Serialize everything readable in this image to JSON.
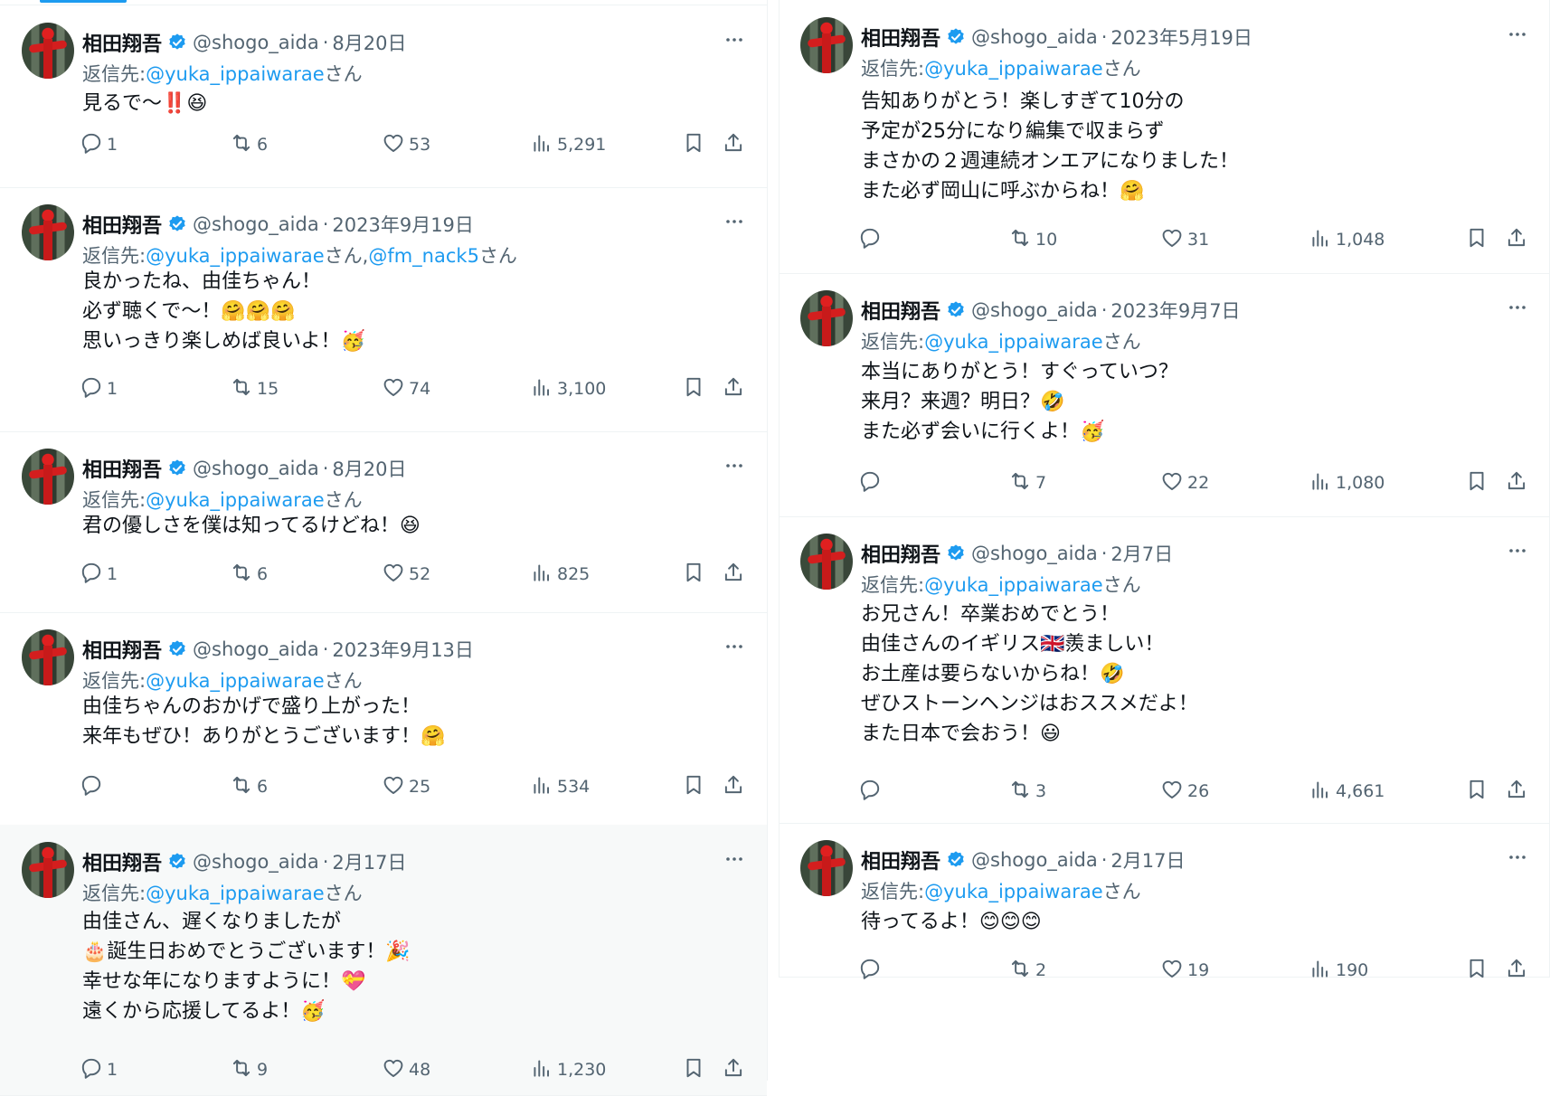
{
  "colors": {
    "accent": "#1d9bf0",
    "text": "#0f1419",
    "muted": "#536471",
    "divider": "#eff3f4",
    "highlight_bg": "#f7f9f9"
  },
  "icons": {
    "verified": "verified-badge-icon",
    "more": "more-options-icon",
    "reply": "reply-icon",
    "retweet": "retweet-icon",
    "like": "like-icon",
    "views": "views-icon",
    "bookmark": "bookmark-icon",
    "share": "share-icon"
  },
  "author": {
    "name": "相田翔吾",
    "handle": "@shogo_aida",
    "separator": "·"
  },
  "reply_label": "返信先:",
  "left_tweets": [
    {
      "date": "8月20日",
      "reply_to": [
        {
          "handle": "@yuka_ippaiwarae",
          "suffix": "さん"
        }
      ],
      "lines": [
        "見るで〜‼️😆"
      ],
      "replies": "1",
      "retweets": "6",
      "likes": "53",
      "views": "5,291"
    },
    {
      "date": "2023年9月19日",
      "reply_to": [
        {
          "handle": "@yuka_ippaiwarae",
          "suffix": "さん,"
        },
        {
          "handle": "@fm_nack5",
          "suffix": "さん"
        }
      ],
      "lines": [
        "良かったね、由佳ちゃん！",
        "必ず聴くで〜！🤗🤗🤗",
        "思いっきり楽しめば良いよ！🥳"
      ],
      "replies": "1",
      "retweets": "15",
      "likes": "74",
      "views": "3,100"
    },
    {
      "date": "8月20日",
      "reply_to": [
        {
          "handle": "@yuka_ippaiwarae",
          "suffix": "さん"
        }
      ],
      "lines": [
        "君の優しさを僕は知ってるけどね！😆"
      ],
      "replies": "1",
      "retweets": "6",
      "likes": "52",
      "views": "825"
    },
    {
      "date": "2023年9月13日",
      "reply_to": [
        {
          "handle": "@yuka_ippaiwarae",
          "suffix": "さん"
        }
      ],
      "lines": [
        "由佳ちゃんのおかげで盛り上がった！",
        "来年もぜひ！ありがとうございます！🤗"
      ],
      "replies": "",
      "retweets": "6",
      "likes": "25",
      "views": "534"
    },
    {
      "date": "2月17日",
      "reply_to": [
        {
          "handle": "@yuka_ippaiwarae",
          "suffix": "さん"
        }
      ],
      "lines": [
        "由佳さん、遅くなりましたが",
        "🎂誕生日おめでとうございます！🎉",
        "幸せな年になりますように！💝",
        "遠くから応援してるよ！🥳"
      ],
      "replies": "1",
      "retweets": "9",
      "likes": "48",
      "views": "1,230"
    }
  ],
  "right_tweets": [
    {
      "date": "2023年5月19日",
      "reply_to": [
        {
          "handle": "@yuka_ippaiwarae",
          "suffix": "さん"
        }
      ],
      "lines": [
        "告知ありがとう！楽しすぎて10分の",
        "予定が25分になり編集で収まらず",
        "まさかの２週連続オンエアになりました！",
        "また必ず岡山に呼ぶからね！🤗"
      ],
      "replies": "",
      "retweets": "10",
      "likes": "31",
      "views": "1,048"
    },
    {
      "date": "2023年9月7日",
      "reply_to": [
        {
          "handle": "@yuka_ippaiwarae",
          "suffix": "さん"
        }
      ],
      "lines": [
        "本当にありがとう！すぐっていつ？",
        "来月？来週？明日？🤣",
        "また必ず会いに行くよ！🥳"
      ],
      "replies": "",
      "retweets": "7",
      "likes": "22",
      "views": "1,080"
    },
    {
      "date": "2月7日",
      "reply_to": [
        {
          "handle": "@yuka_ippaiwarae",
          "suffix": "さん"
        }
      ],
      "lines": [
        "お兄さん！卒業おめでとう！",
        "由佳さんのイギリス🇬🇧羨ましい！",
        "お土産は要らないからね！🤣",
        "ぜひストーンヘンジはおススメだよ！",
        "また日本で会おう！😃"
      ],
      "replies": "",
      "retweets": "3",
      "likes": "26",
      "views": "4,661"
    },
    {
      "date": "2月17日",
      "reply_to": [
        {
          "handle": "@yuka_ippaiwarae",
          "suffix": "さん"
        }
      ],
      "lines": [
        "待ってるよ！😊😊😊"
      ],
      "replies": "",
      "retweets": "2",
      "likes": "19",
      "views": "190"
    }
  ]
}
